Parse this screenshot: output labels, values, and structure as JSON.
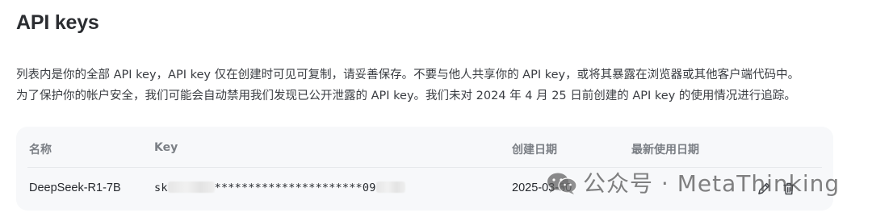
{
  "page": {
    "title": "API keys",
    "description_line1": "列表内是你的全部 API key，API key 仅在创建时可见可复制，请妥善保存。不要与他人共享你的 API key，或将其暴露在浏览器或其他客户端代码中。",
    "description_line2": "为了保护你的帐户安全，我们可能会自动禁用我们发现已公开泄露的 API key。我们未对 2024 年 4 月 25 日前创建的 API key 的使用情况进行追踪。"
  },
  "table": {
    "headers": {
      "name": "名称",
      "key": "Key",
      "created": "创建日期",
      "last_used": "最新使用日期"
    },
    "rows": [
      {
        "name": "DeepSeek-R1-7B",
        "key_prefix": "sk",
        "key_masked": "**********************09",
        "created": "2025-03-30",
        "last_used": ""
      }
    ]
  },
  "icons": {
    "edit": "pencil-icon",
    "delete": "trash-icon",
    "watermark": "wechat-icon"
  },
  "watermark": {
    "text": "公众号 · MetaThinking"
  }
}
